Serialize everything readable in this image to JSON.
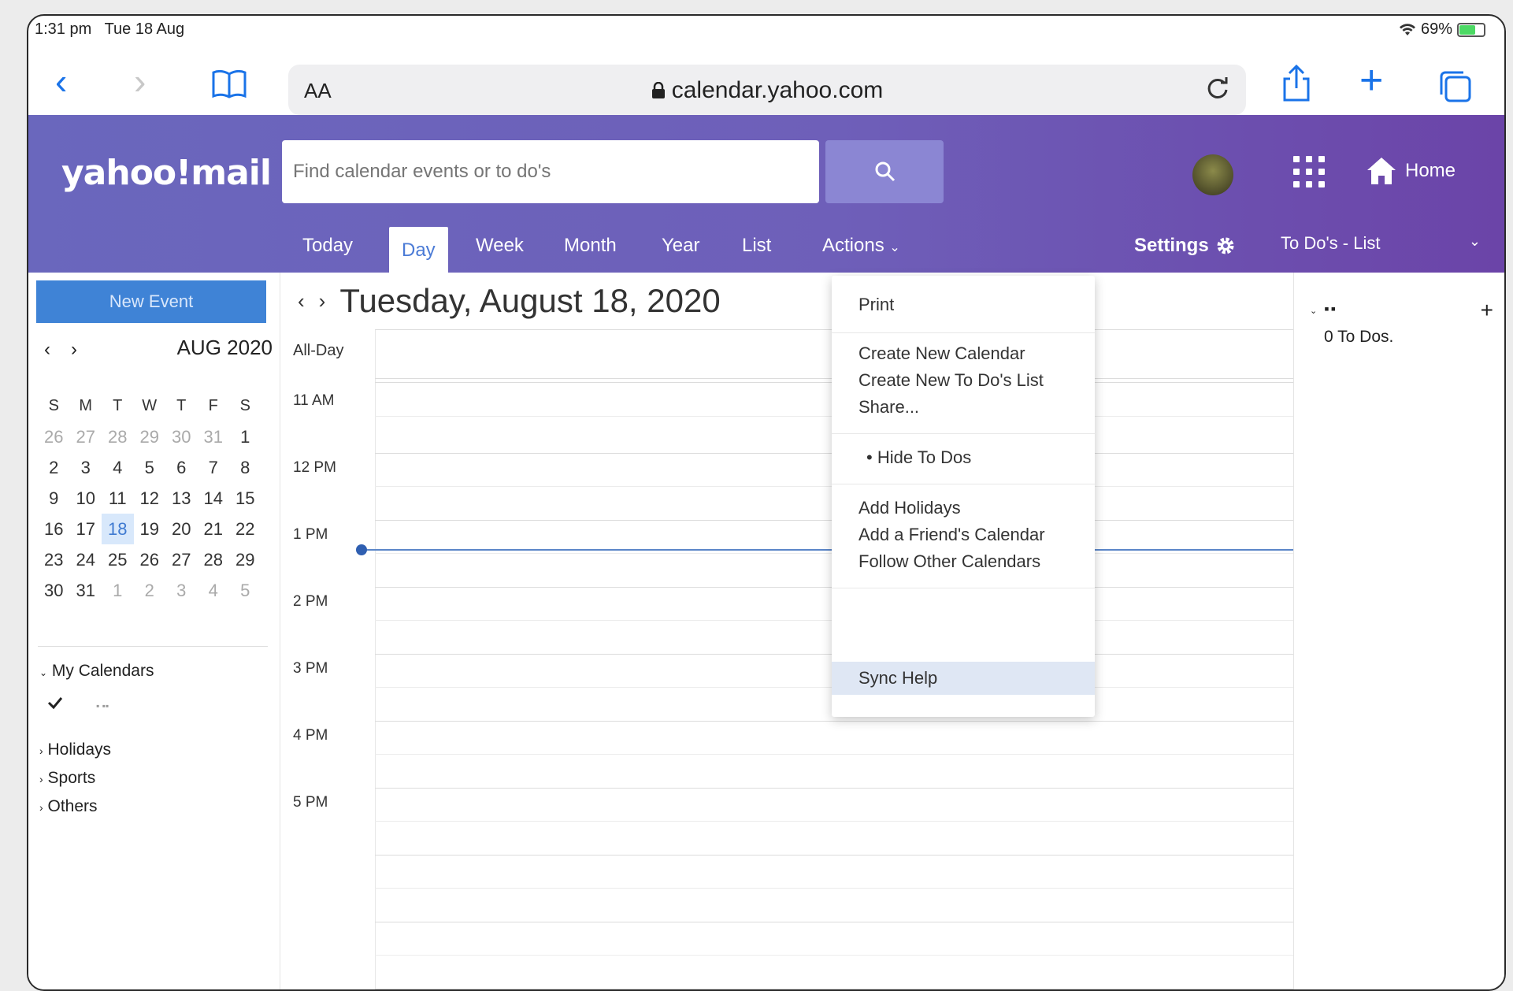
{
  "status": {
    "time": "1:31 pm",
    "date": "Tue 18 Aug",
    "battery": "69%",
    "battery_level": 0.69
  },
  "browser": {
    "text_size": "AA",
    "url": "calendar.yahoo.com"
  },
  "header": {
    "logo": "yahoo!mail",
    "search_placeholder": "Find calendar events or to do's",
    "home": "Home"
  },
  "tabs": [
    "Today",
    "Day",
    "Week",
    "Month",
    "Year",
    "List",
    "Actions"
  ],
  "settings": "Settings",
  "todo_list_label": "To Do's - List",
  "sidebar": {
    "new_event": "New Event",
    "month_label": "AUG 2020",
    "weekdays": [
      "S",
      "M",
      "T",
      "W",
      "T",
      "F",
      "S"
    ],
    "weeks": [
      [
        "26",
        "27",
        "28",
        "29",
        "30",
        "31",
        "1"
      ],
      [
        "2",
        "3",
        "4",
        "5",
        "6",
        "7",
        "8"
      ],
      [
        "9",
        "10",
        "11",
        "12",
        "13",
        "14",
        "15"
      ],
      [
        "16",
        "17",
        "18",
        "19",
        "20",
        "21",
        "22"
      ],
      [
        "23",
        "24",
        "25",
        "26",
        "27",
        "28",
        "29"
      ],
      [
        "30",
        "31",
        "1",
        "2",
        "3",
        "4",
        "5"
      ]
    ],
    "today_day": "18",
    "my_calendars": "My Calendars",
    "my_calendar_item": "▪ ▪▪",
    "categories": [
      "Holidays",
      "Sports",
      "Others"
    ]
  },
  "main": {
    "date_title": "Tuesday, August 18, 2020",
    "all_day": "All-Day",
    "hours": [
      "11 AM",
      "12 PM",
      "1 PM",
      "2 PM",
      "3 PM",
      "4 PM",
      "5 PM"
    ]
  },
  "actions_menu": {
    "print": "Print",
    "create_calendar": "Create New Calendar",
    "create_todo_list": "Create New To Do's List",
    "share": "Share...",
    "hide_todos": "Hide To Dos",
    "add_holidays": "Add Holidays",
    "add_friend_calendar": "Add a Friend's Calendar",
    "follow_calendars": "Follow Other Calendars",
    "sync_help": "Sync Help"
  },
  "todo_panel": {
    "name": "▪▪",
    "count": "0 To Dos."
  },
  "colors": {
    "header": "#6a67bd",
    "accent": "#3f83d6",
    "today": "#d8e8fb",
    "now_line": "#5b86c8"
  }
}
